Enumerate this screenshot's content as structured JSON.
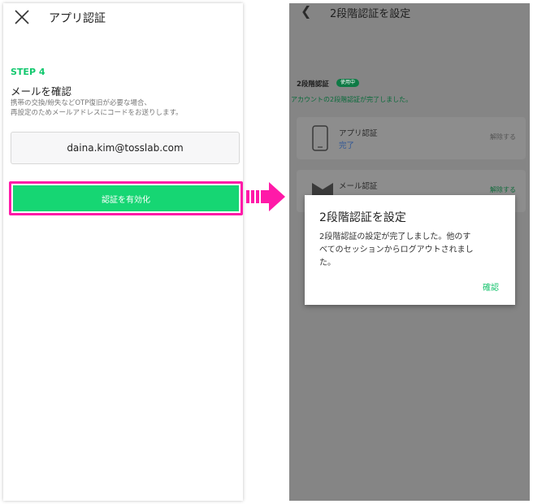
{
  "left_screen": {
    "title": "アプリ認証",
    "step_label": "STEP 4",
    "heading": "メールを確認",
    "description_line1": "携帯の交換/紛失などOTP復旧が必要な場合、",
    "description_line2": "再設定のためメールアドレスにコードをお送りします。",
    "email_value": "daina.kim@tosslab.com",
    "enable_button_label": "認証を有効化",
    "icons": {
      "close": "close-icon"
    }
  },
  "arrow": {
    "color": "#ff1aa8",
    "icon": "arrow-right-icon"
  },
  "right_screen": {
    "title": "2段階認証を設定",
    "section_title": "2段階認証",
    "badge_label": "使用中",
    "complete_message": "アカウントの2段階認証が完了しました。",
    "methods": [
      {
        "name": "アプリ認証",
        "status": "完了",
        "action": "解除する",
        "icon": "phone-icon"
      },
      {
        "name": "メール認証",
        "status": "",
        "action": "解除する",
        "icon": "mail-icon"
      }
    ],
    "icons": {
      "back": "back-arrow-icon"
    }
  },
  "dialog": {
    "title": "2段階認証を設定",
    "body_line1": "2段階認証の設定が完了しました。他のす",
    "body_line2": "べてのセッションからログアウトされまし",
    "body_line3": "た。",
    "confirm_label": "確認"
  },
  "colors": {
    "accent_green": "#16d673",
    "highlight_pink": "#ff1aa8",
    "overlay_gray": "#858585"
  }
}
